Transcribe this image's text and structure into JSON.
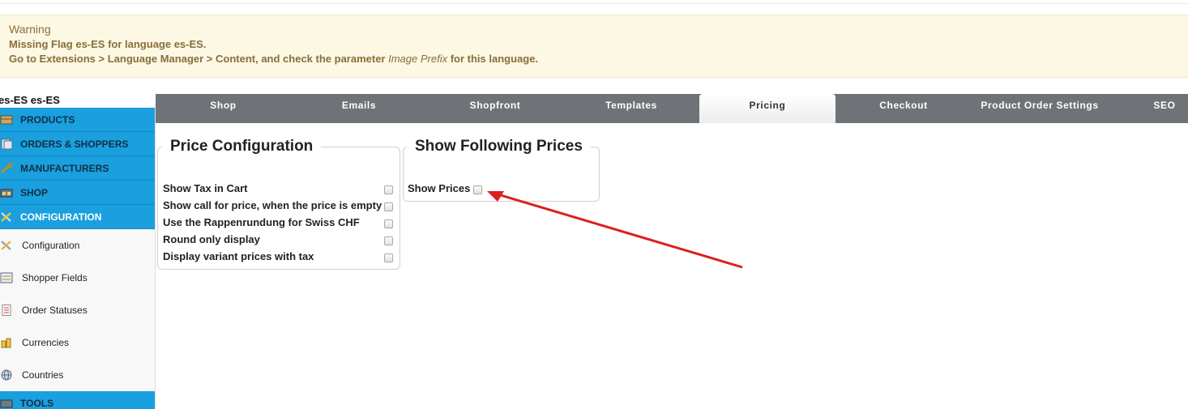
{
  "warning": {
    "title": "Warning",
    "line1": "Missing Flag es-ES for language es-ES.",
    "line2_prefix": "Go to Extensions > Language Manager > Content, and check the parameter ",
    "line2_param": "Image Prefix",
    "line2_suffix": " for this language."
  },
  "language_label": "es-ES es-ES",
  "sidebar": {
    "headers": [
      {
        "label": "PRODUCTS",
        "icon": "products-icon"
      },
      {
        "label": "ORDERS & SHOPPERS",
        "icon": "orders-icon"
      },
      {
        "label": "MANUFACTURERS",
        "icon": "wrench-icon"
      },
      {
        "label": "SHOP",
        "icon": "shop-icon"
      },
      {
        "label": "CONFIGURATION",
        "icon": "configuration-icon"
      }
    ],
    "sub_items": [
      {
        "label": "Configuration",
        "icon": "tools-icon"
      },
      {
        "label": "Shopper Fields",
        "icon": "form-icon"
      },
      {
        "label": "Order Statuses",
        "icon": "list-icon"
      },
      {
        "label": "Currencies",
        "icon": "coins-icon"
      },
      {
        "label": "Countries",
        "icon": "globe-icon"
      }
    ],
    "tools": {
      "label": "TOOLS",
      "icon": "tools-menu-icon"
    }
  },
  "tabs": [
    "Shop",
    "Emails",
    "Shopfront",
    "Templates",
    "Pricing",
    "Checkout",
    "Product Order Settings",
    "SEO"
  ],
  "active_tab": "Pricing",
  "price_config": {
    "legend": "Price Configuration",
    "options": [
      "Show Tax in Cart",
      "Show call for price, when the price is empty",
      "Use the Rappenrundung for Swiss CHF",
      "Round only display",
      "Display variant prices with tax"
    ]
  },
  "show_prices": {
    "legend": "Show Following Prices",
    "option": "Show Prices"
  },
  "colors": {
    "sidebar_accent": "#1a9fdf",
    "tab_bar": "#6f7377",
    "warning_bg": "#fcf8e3",
    "annotation_arrow": "#dd1f1f"
  }
}
